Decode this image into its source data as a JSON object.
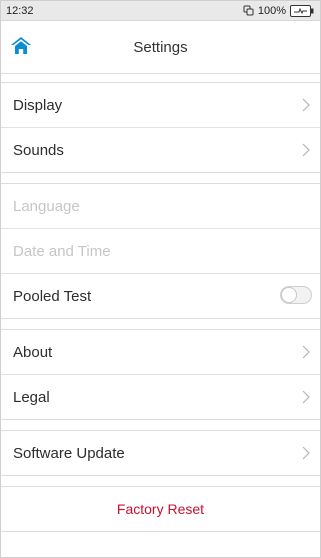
{
  "status_bar": {
    "time": "12:32",
    "battery_percent": "100%",
    "icons": [
      "sync-icon",
      "battery-charging-icon"
    ]
  },
  "header": {
    "title": "Settings",
    "home_icon": "home-icon",
    "accent_color": "#0a8fd1"
  },
  "sections": [
    {
      "items": [
        {
          "label": "Display",
          "type": "link"
        },
        {
          "label": "Sounds",
          "type": "link"
        }
      ]
    },
    {
      "items": [
        {
          "label": "Language",
          "type": "disabled"
        },
        {
          "label": "Date and Time",
          "type": "disabled"
        },
        {
          "label": "Pooled Test",
          "type": "toggle",
          "enabled": false
        }
      ]
    },
    {
      "items": [
        {
          "label": "About",
          "type": "link"
        },
        {
          "label": "Legal",
          "type": "link"
        }
      ]
    },
    {
      "items": [
        {
          "label": "Software Update",
          "type": "link"
        }
      ]
    },
    {
      "items": [
        {
          "label": "Factory Reset",
          "type": "action",
          "color": "#c8102e"
        }
      ]
    }
  ]
}
